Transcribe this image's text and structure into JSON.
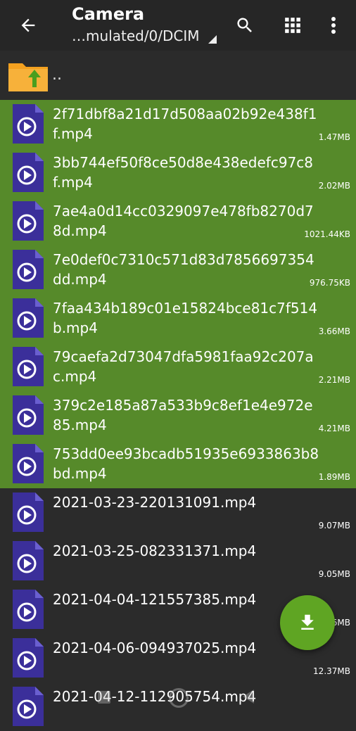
{
  "appbar": {
    "title": "Camera",
    "path": "…mulated/0/DCIM"
  },
  "parent_label": "..",
  "files": [
    {
      "name": "2f71dbf8a21d17d508aa02b92e438f1f.mp4",
      "size": "1.47MB",
      "selected": true
    },
    {
      "name": "3bb744ef50f8ce50d8e438edefc97c8f.mp4",
      "size": "2.02MB",
      "selected": true
    },
    {
      "name": "7ae4a0d14cc0329097e478fb8270d78d.mp4",
      "size": "1021.44KB",
      "selected": true
    },
    {
      "name": "7e0def0c7310c571d83d7856697354dd.mp4",
      "size": "976.75KB",
      "selected": true
    },
    {
      "name": "7faa434b189c01e15824bce81c7f514b.mp4",
      "size": "3.66MB",
      "selected": true
    },
    {
      "name": "79caefa2d73047dfa5981faa92c207ac.mp4",
      "size": "2.21MB",
      "selected": true
    },
    {
      "name": "379c2e185a87a533b9c8ef1e4e972e85.mp4",
      "size": "4.21MB",
      "selected": true
    },
    {
      "name": "753dd0ee93bcadb51935e6933863b8bd.mp4",
      "size": "1.89MB",
      "selected": true
    },
    {
      "name": "2021-03-23-220131091.mp4",
      "size": "9.07MB",
      "selected": false
    },
    {
      "name": "2021-03-25-082331371.mp4",
      "size": "9.05MB",
      "selected": false
    },
    {
      "name": "2021-04-04-121557385.mp4",
      "size": "…6MB",
      "selected": false
    },
    {
      "name": "2021-04-06-094937025.mp4",
      "size": "12.37MB",
      "selected": false
    },
    {
      "name": "2021-04-12-112905754.mp4",
      "size": "",
      "selected": false
    }
  ],
  "colors": {
    "selected_row": "#568a2a",
    "fab": "#5fa523",
    "video_icon": "#3b2f9a",
    "folder": "#f4a11f"
  },
  "icons": {
    "back": "arrow-left-icon",
    "search": "search-icon",
    "grid": "grid-view-icon",
    "more": "more-vert-icon",
    "fab": "download-icon"
  }
}
